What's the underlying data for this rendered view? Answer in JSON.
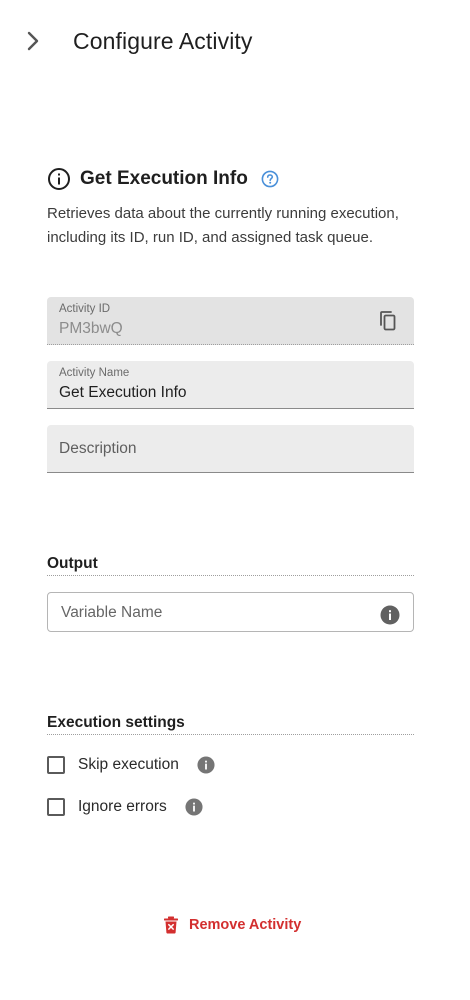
{
  "header": {
    "title": "Configure Activity",
    "collapse_icon": "chevron-right-icon"
  },
  "activity": {
    "title": "Get Execution Info",
    "description": "Retrieves data about the currently running execution, including its ID, run ID, and assigned task queue."
  },
  "fields": {
    "activity_id": {
      "label": "Activity ID",
      "value": "PM3bwQ"
    },
    "activity_name": {
      "label": "Activity Name",
      "value": "Get Execution Info"
    },
    "description": {
      "placeholder": "Description"
    }
  },
  "output": {
    "section_label": "Output",
    "variable_placeholder": "Variable Name"
  },
  "execution_settings": {
    "section_label": "Execution settings",
    "skip_label": "Skip execution",
    "ignore_label": "Ignore errors",
    "skip_checked": false,
    "ignore_checked": false
  },
  "actions": {
    "remove_label": "Remove Activity"
  },
  "colors": {
    "accent_blue": "#4a90d9",
    "danger_red": "#d32f2f",
    "info_grey": "#616161"
  }
}
